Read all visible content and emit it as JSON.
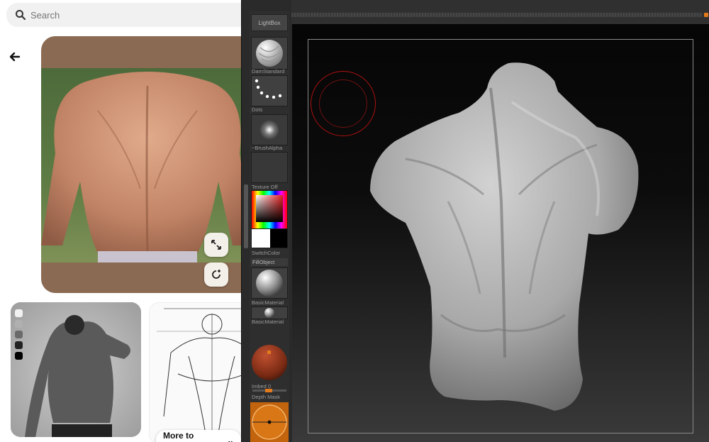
{
  "browser": {
    "search": {
      "placeholder": "Search",
      "icon": "search-icon"
    },
    "back_icon": "arrow-left-icon",
    "pin": {
      "background_color": "#8a6a52",
      "expand_icon": "expand-icon",
      "visual_search_icon": "visual-search-icon"
    },
    "more_to_explore": "More to explore",
    "swatch_colors": [
      "#f2f2f2",
      "#b0b0b0",
      "#6a6a6a",
      "#222222",
      "#000000"
    ]
  },
  "zbrush": {
    "lightbox": "LightBox",
    "tray": [
      {
        "label": "DamStandard",
        "kind": "brush"
      },
      {
        "label": "Dots",
        "kind": "stroke"
      },
      {
        "label": "~BrushAlpha",
        "kind": "alpha"
      },
      {
        "label": "Texture Off",
        "kind": "texture"
      }
    ],
    "switch_color": "SwitchColor",
    "fill_object": "FillObject",
    "materials": [
      "BasicMaterial",
      "BasicMaterial"
    ],
    "imbed": {
      "label": "Imbed",
      "value": "0"
    },
    "depth_mask": "Depth Mask",
    "accent": "#e07a1c"
  }
}
